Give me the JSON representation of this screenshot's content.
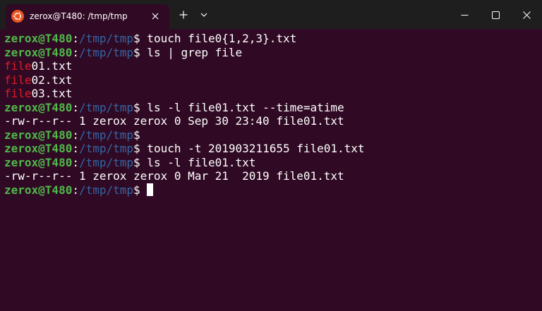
{
  "window": {
    "tab_title": "zerox@T480: /tmp/tmp",
    "tab_icon": "ubuntu-icon",
    "colors": {
      "titlebar": "#1e1e1e",
      "terminal_bg": "#300a24",
      "prompt_user": "#4fb84a",
      "prompt_path": "#3465a4",
      "grep_match": "#e01b24",
      "ubuntu_orange": "#e95420"
    }
  },
  "terminal": {
    "lines": [
      {
        "type": "prompt",
        "user": "zerox@T480",
        "sep": ":",
        "path": "/tmp/tmp",
        "dollar": "$",
        "cmd": " touch file0{1,2,3}.txt"
      },
      {
        "type": "prompt",
        "user": "zerox@T480",
        "sep": ":",
        "path": "/tmp/tmp",
        "dollar": "$",
        "cmd": " ls | grep file"
      },
      {
        "type": "match",
        "match": "file",
        "rest": "01.txt"
      },
      {
        "type": "match",
        "match": "file",
        "rest": "02.txt"
      },
      {
        "type": "match",
        "match": "file",
        "rest": "03.txt"
      },
      {
        "type": "prompt",
        "user": "zerox@T480",
        "sep": ":",
        "path": "/tmp/tmp",
        "dollar": "$",
        "cmd": " ls -l file01.txt --time=atime"
      },
      {
        "type": "output",
        "text": "-rw-r--r-- 1 zerox zerox 0 Sep 30 23:40 file01.txt"
      },
      {
        "type": "prompt",
        "user": "zerox@T480",
        "sep": ":",
        "path": "/tmp/tmp",
        "dollar": "$",
        "cmd": ""
      },
      {
        "type": "prompt",
        "user": "zerox@T480",
        "sep": ":",
        "path": "/tmp/tmp",
        "dollar": "$",
        "cmd": " touch -t 201903211655 file01.txt"
      },
      {
        "type": "prompt",
        "user": "zerox@T480",
        "sep": ":",
        "path": "/tmp/tmp",
        "dollar": "$",
        "cmd": " ls -l file01.txt"
      },
      {
        "type": "output",
        "text": "-rw-r--r-- 1 zerox zerox 0 Mar 21  2019 file01.txt"
      },
      {
        "type": "prompt",
        "user": "zerox@T480",
        "sep": ":",
        "path": "/tmp/tmp",
        "dollar": "$",
        "cmd": " ",
        "cursor": true
      }
    ]
  }
}
